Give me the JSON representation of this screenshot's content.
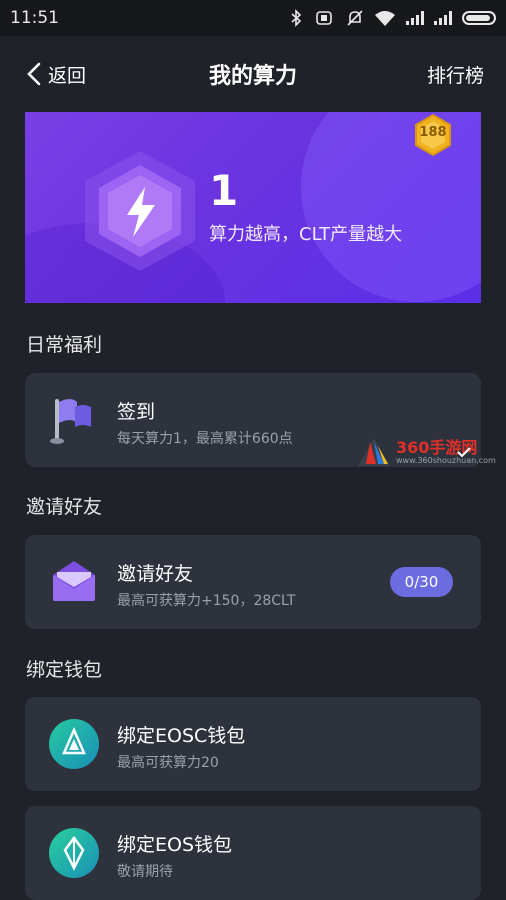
{
  "status_bar": {
    "time": "11:51"
  },
  "nav": {
    "back_label": "返回",
    "title": "我的算力",
    "right_label": "排行榜"
  },
  "banner": {
    "value": "1",
    "subtitle": "算力越高，CLT产量越大",
    "rank": "188"
  },
  "sections": {
    "daily": "日常福利",
    "invite": "邀请好友",
    "wallet": "绑定钱包"
  },
  "cards": {
    "sign_in": {
      "title": "签到",
      "subtitle": "每天算力1，最高累计660点"
    },
    "invite": {
      "title": "邀请好友",
      "subtitle": "最高可获算力+150，28CLT",
      "count": "0/30"
    },
    "eosc": {
      "title": "绑定EOSC钱包",
      "subtitle": "最高可获算力20"
    },
    "eos": {
      "title": "绑定EOS钱包",
      "subtitle": "敬请期待"
    }
  },
  "watermark": {
    "text": "360手游网",
    "url": "www.360shouzhuan.com"
  },
  "colors": {
    "background": "#1f2228",
    "card": "#2e323c",
    "banner_purple": "#6a33e0",
    "pill": "#6a6ce0",
    "teal": "#1fb89a"
  }
}
